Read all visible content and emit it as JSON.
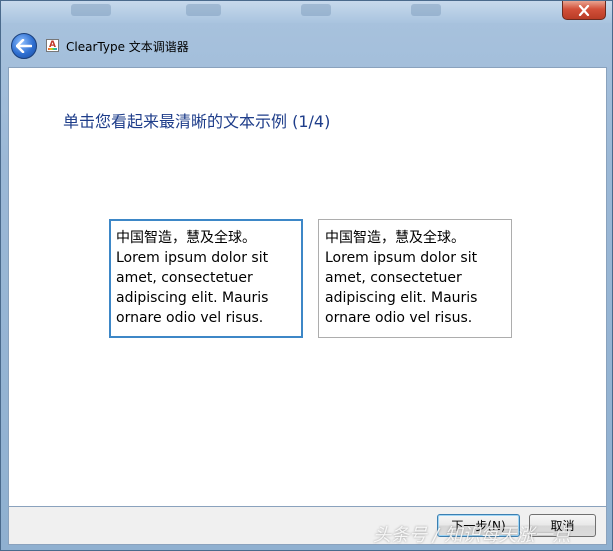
{
  "window": {
    "app_title": "ClearType 文本调谐器"
  },
  "main": {
    "instruction": "单击您看起来最清晰的文本示例 (1/4)",
    "samples": [
      {
        "cjk": "中国智造，慧及全球。",
        "latin": "Lorem ipsum dolor sit amet, consectetuer adipiscing elit. Mauris ornare odio vel risus."
      },
      {
        "cjk": "中国智造，慧及全球。",
        "latin": "Lorem ipsum dolor sit amet, consectetuer adipiscing elit. Mauris ornare odio vel risus."
      }
    ]
  },
  "footer": {
    "next_label": "下一步(N)",
    "cancel_label": "取消"
  },
  "watermark": "头条号 / 知识每天涨一点",
  "icons": {
    "back": "back-arrow-icon",
    "close": "close-icon",
    "app": "cleartype-app-icon"
  },
  "colors": {
    "instruction": "#1e3d8a",
    "selected_border": "#3d87c7"
  }
}
